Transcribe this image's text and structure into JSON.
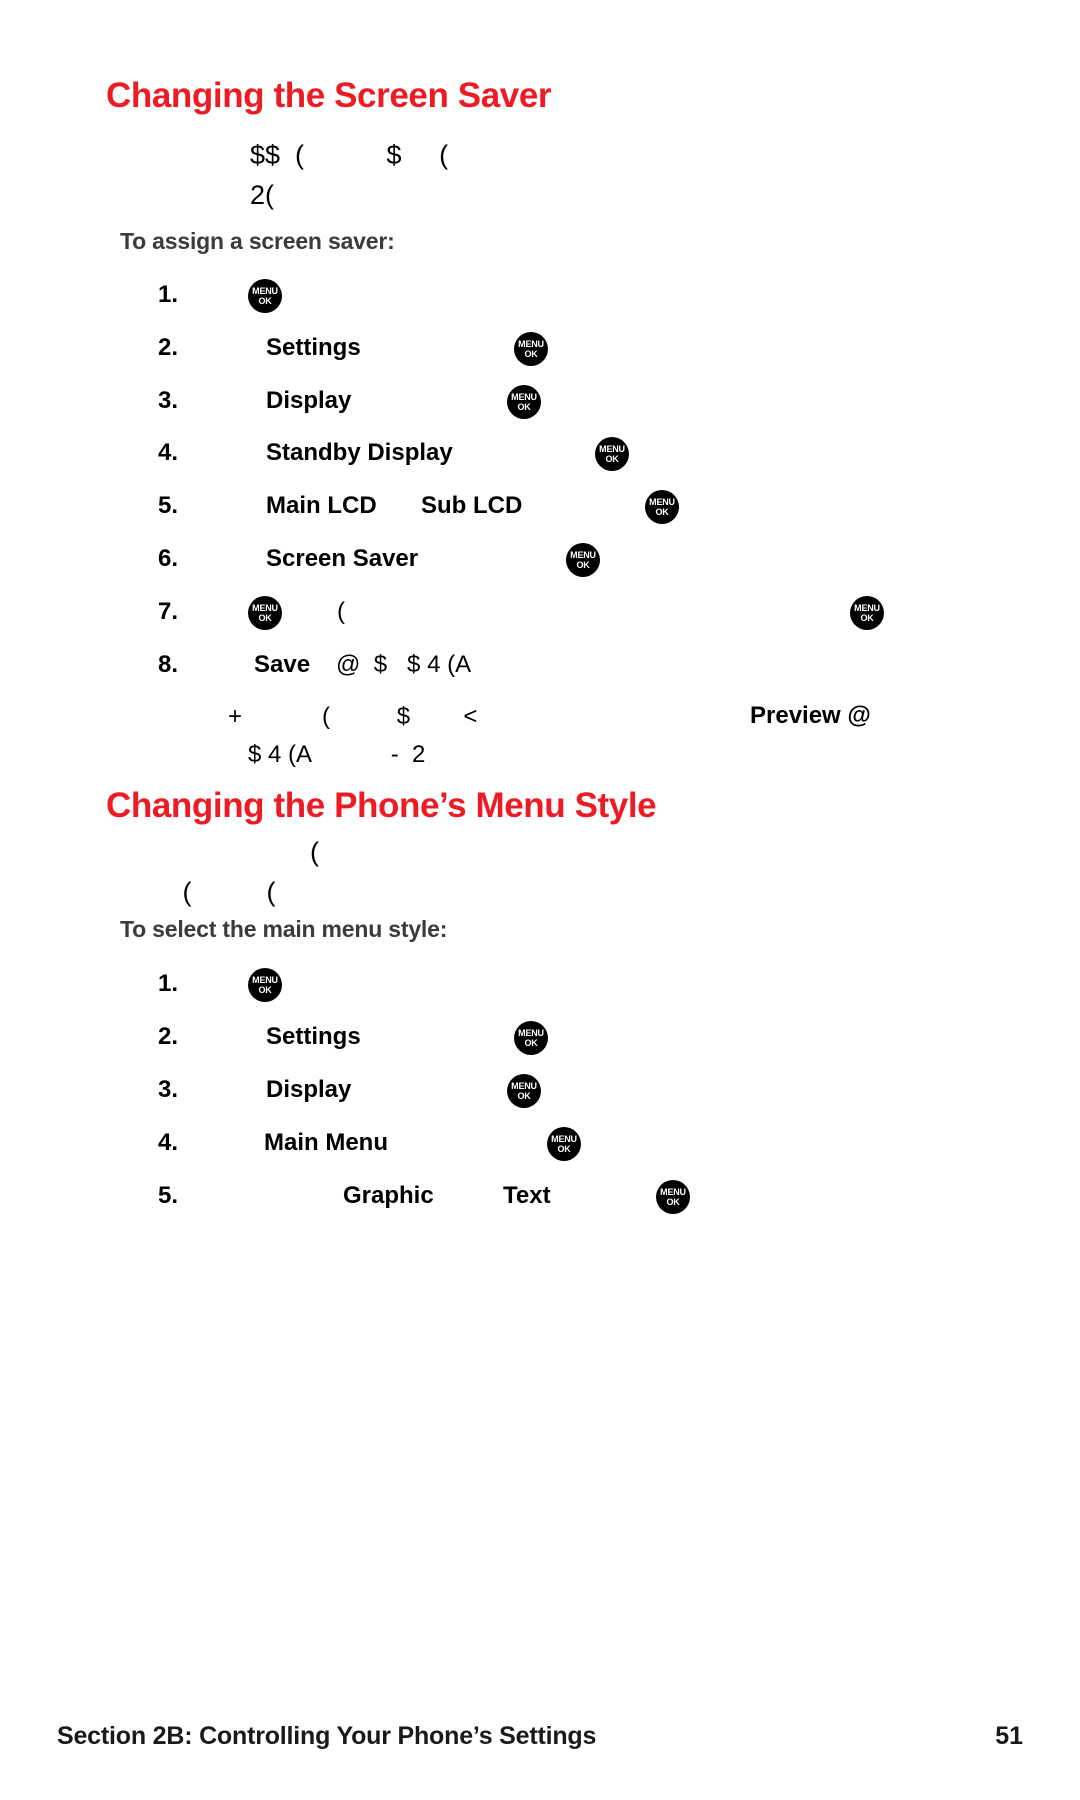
{
  "document": {
    "sections": [
      {
        "id": "screen-saver",
        "heading": "Changing the Screen Saver",
        "intro_lines": "$$  (           $     (\n2(",
        "lead_in": "To assign a screen saver:",
        "steps": [
          {
            "num": "1.",
            "bold": "",
            "plain": ""
          },
          {
            "num": "2.",
            "bold": "Settings",
            "plain": ""
          },
          {
            "num": "3.",
            "bold": "Display",
            "plain": ""
          },
          {
            "num": "4.",
            "bold": "Standby Display",
            "plain": ""
          },
          {
            "num": "5.",
            "bold": "Main LCD",
            "bold2": "Sub LCD",
            "plain": ""
          },
          {
            "num": "6.",
            "bold": "Screen Saver",
            "plain": ""
          },
          {
            "num": "7.",
            "bold": "",
            "plain": "("
          },
          {
            "num": "8.",
            "bold": "Save",
            "plain": "@  $   $ 4 (A"
          }
        ],
        "note_line1_plain": "+            (          $        <",
        "note_line1_bold": "Preview @",
        "note_line2_plain": "$ 4 (A            -  2"
      },
      {
        "id": "menu-style",
        "heading": "Changing the Phone’s Menu Style",
        "intro_lines": "                  (\n (          (",
        "lead_in": "To select the main menu style:",
        "steps": [
          {
            "num": "1.",
            "bold": "",
            "plain": ""
          },
          {
            "num": "2.",
            "bold": "Settings",
            "plain": ""
          },
          {
            "num": "3.",
            "bold": "Display",
            "plain": ""
          },
          {
            "num": "4.",
            "bold": "Main Menu",
            "plain": ""
          },
          {
            "num": "5.",
            "bold": "Graphic",
            "bold2": "Text",
            "plain": ""
          }
        ]
      }
    ]
  },
  "menu_key": {
    "top_label": "MENU",
    "bottom_label": "OK",
    "name": "menu-ok-key-icon"
  },
  "footer": {
    "text": "Section 2B: Controlling Your Phone’s Settings",
    "page_number": "51"
  },
  "colors": {
    "heading_red": "#ed1c24",
    "lead_in_gray": "#3b3b3b",
    "body_black": "#000000"
  }
}
